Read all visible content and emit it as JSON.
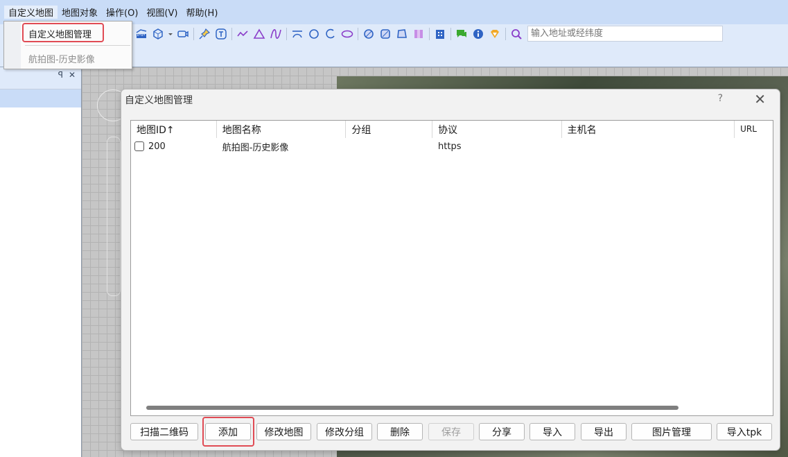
{
  "menubar": {
    "items": [
      "自定义地图",
      "地图对象",
      "操作(O)",
      "视图(V)",
      "帮助(H)"
    ]
  },
  "dropdown": {
    "items": [
      "自定义地图管理",
      "航拍图-历史影像"
    ]
  },
  "toolbar": {
    "search_placeholder": "输入地址或经纬度",
    "icons": [
      "ruler-icon",
      "polyhedron-icon",
      "camera-icon",
      "pin-icon",
      "text-icon",
      "polyline-icon",
      "triangle-icon",
      "curve-icon",
      "arc-line-icon",
      "circle-icon",
      "arc-icon",
      "ellipse-icon",
      "filled-circle-icon",
      "filled-square-icon",
      "polygon-icon",
      "bars-icon",
      "building-icon",
      "comment-icon",
      "info-icon",
      "diamond-icon",
      "search-icon"
    ]
  },
  "left_panel": {
    "pin_glyph": "ꟼ",
    "close_glyph": "✕"
  },
  "dialog": {
    "title": "自定义地图管理",
    "help": "?",
    "close": "✕",
    "columns": [
      "地图ID↑",
      "地图名称",
      "分组",
      "协议",
      "主机名",
      "URL"
    ],
    "rows": [
      {
        "id": "200",
        "name": "航拍图-历史影像",
        "group": "",
        "protocol": "https",
        "host": "",
        "url": ""
      }
    ],
    "buttons": {
      "scan_qr": "扫描二维码",
      "add": "添加",
      "edit_map": "修改地图",
      "edit_group": "修改分组",
      "delete": "删除",
      "save": "保存",
      "share": "分享",
      "import": "导入",
      "export": "导出",
      "image_manage": "图片管理",
      "import_tpk": "导入tpk"
    }
  },
  "colors": {
    "menubar_bg": "#c9dcf7",
    "highlight_red": "#e04b54",
    "toolbar_blue": "#2f64c4",
    "toolbar_purple": "#8a3dc9"
  }
}
